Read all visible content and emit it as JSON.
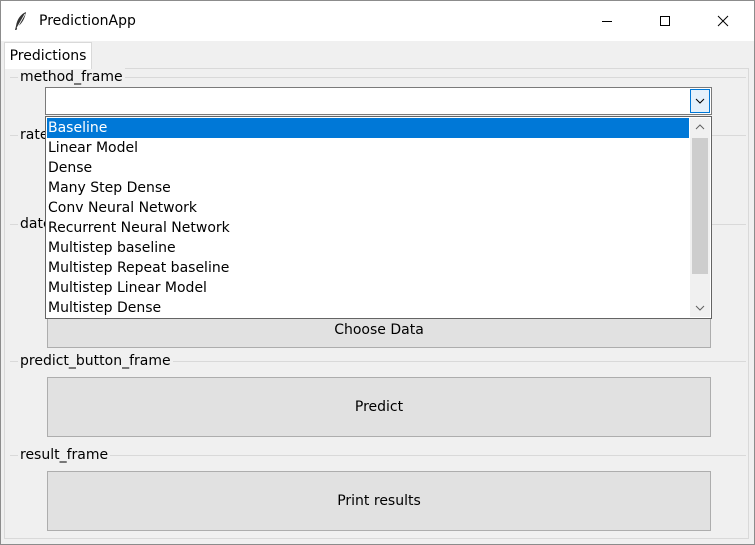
{
  "window": {
    "title": "PredictionApp"
  },
  "tabs": [
    {
      "label": "Predictions",
      "active": true
    }
  ],
  "frames": {
    "method": {
      "label": "method_frame"
    },
    "rates": {
      "label": "rates"
    },
    "dates": {
      "label": "date"
    },
    "predict": {
      "label": "predict_button_frame",
      "button_label": "Predict"
    },
    "result": {
      "label": "result_frame",
      "button_label": "Print results"
    }
  },
  "choose_data_button": {
    "label": "Choose Data"
  },
  "method_combo": {
    "value": "",
    "selected_index": 0,
    "options": [
      "Baseline",
      "Linear Model",
      "Dense",
      "Many Step Dense",
      "Conv Neural Network",
      "Recurrent Neural Network",
      "Multistep baseline",
      "Multistep Repeat baseline",
      "Multistep Linear Model",
      "Multistep Dense"
    ]
  },
  "colors": {
    "selection": "#0078d7",
    "button_face": "#e1e1e1",
    "window_bg": "#f0f0f0"
  },
  "icons": {
    "app": "feather-icon",
    "minimize": "minimize-icon",
    "maximize": "maximize-icon",
    "close": "close-icon",
    "dropdown": "chevron-down-icon"
  }
}
